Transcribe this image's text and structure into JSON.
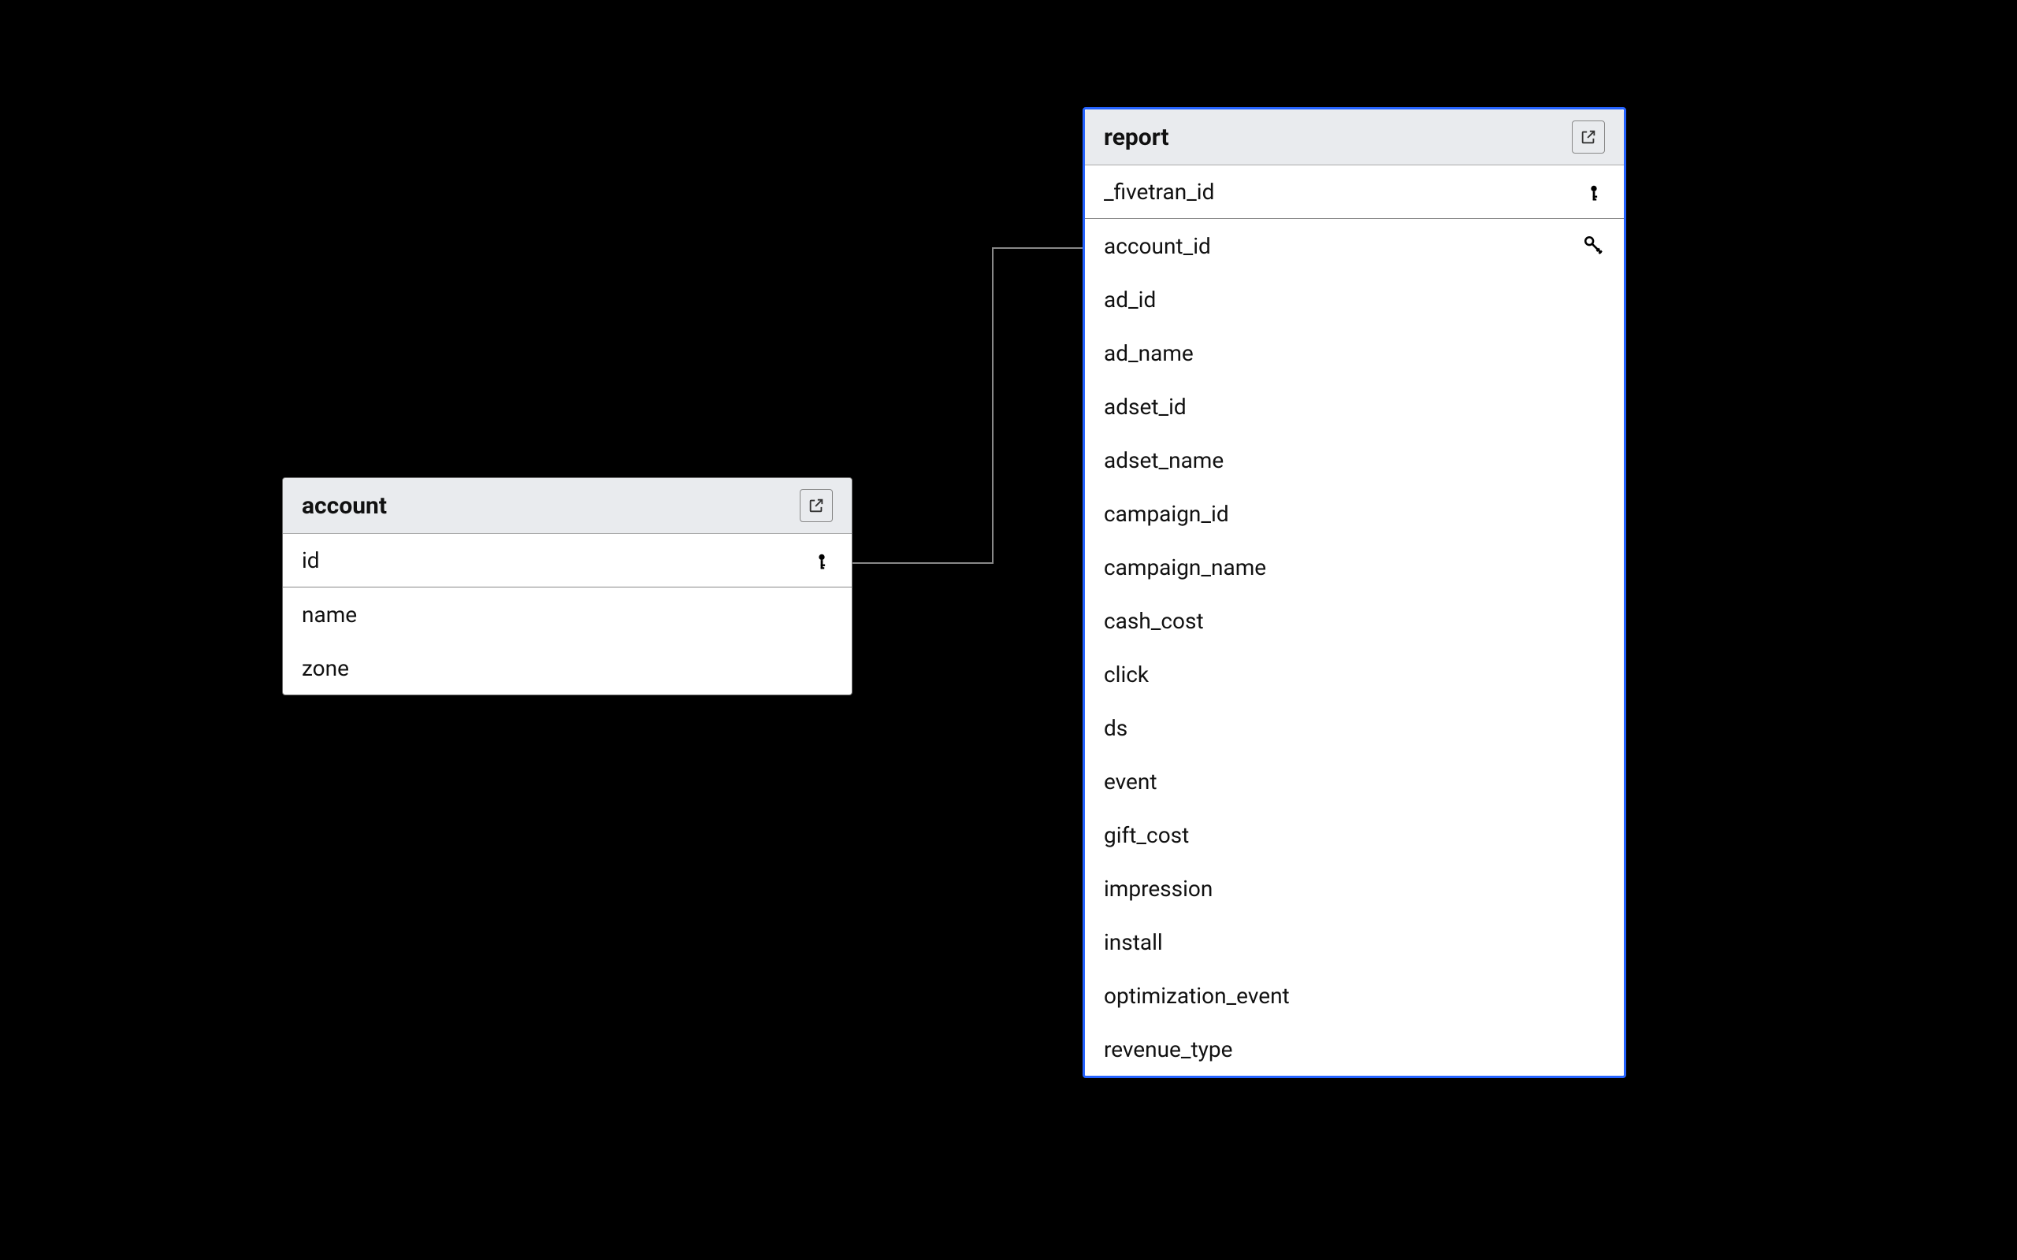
{
  "tables": {
    "account": {
      "title": "account",
      "columns": [
        {
          "name": "id",
          "key": "pk"
        },
        {
          "name": "name",
          "key": null
        },
        {
          "name": "zone",
          "key": null
        }
      ]
    },
    "report": {
      "title": "report",
      "columns": [
        {
          "name": "_fivetran_id",
          "key": "pk"
        },
        {
          "name": "account_id",
          "key": "fk"
        },
        {
          "name": "ad_id",
          "key": null
        },
        {
          "name": "ad_name",
          "key": null
        },
        {
          "name": "adset_id",
          "key": null
        },
        {
          "name": "adset_name",
          "key": null
        },
        {
          "name": "campaign_id",
          "key": null
        },
        {
          "name": "campaign_name",
          "key": null
        },
        {
          "name": "cash_cost",
          "key": null
        },
        {
          "name": "click",
          "key": null
        },
        {
          "name": "ds",
          "key": null
        },
        {
          "name": "event",
          "key": null
        },
        {
          "name": "gift_cost",
          "key": null
        },
        {
          "name": "impression",
          "key": null
        },
        {
          "name": "install",
          "key": null
        },
        {
          "name": "optimization_event",
          "key": null
        },
        {
          "name": "revenue_type",
          "key": null
        }
      ]
    }
  },
  "relation": {
    "from": "account.id",
    "to": "report.account_id"
  }
}
